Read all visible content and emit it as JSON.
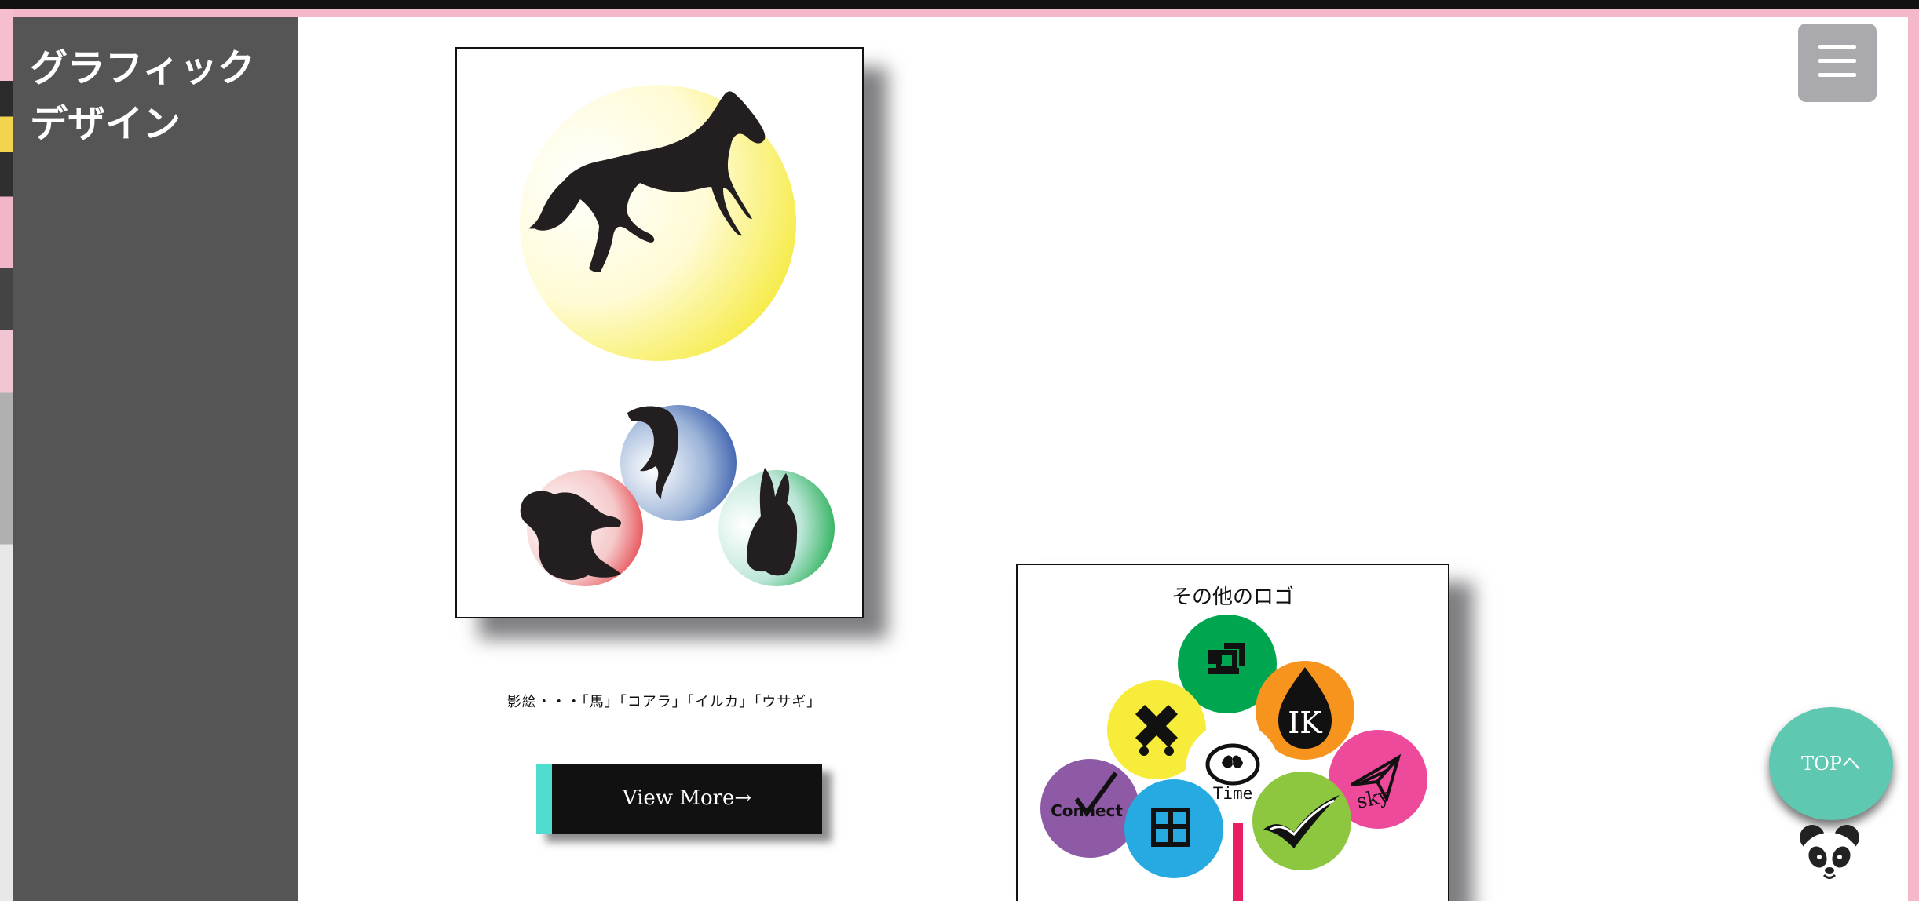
{
  "sidebar": {
    "title": "グラフィック\nデザイン"
  },
  "header": {
    "menu_icon": "hamburger-menu-icon"
  },
  "gallery": {
    "caption": "影絵・・・「馬」「コアラ」「イルカ」「ウサギ」",
    "view_more_label": "View More→"
  },
  "logo_section": {
    "title": "その他のロゴ",
    "logo_texts": [
      "IK",
      "Time",
      "Connect",
      "sky"
    ]
  },
  "floating": {
    "top_label": "TOPへ",
    "mascot_icon": "panda-icon"
  },
  "colors": {
    "sidebar": "#555555",
    "button_accent": "#4fddd0",
    "top_button": "#5ec8b0",
    "green": "#00a550",
    "orange": "#f7941d",
    "pink": "#ee4a9c",
    "lime": "#8dc63f",
    "blue": "#27aae1",
    "purple": "#8f5aa5",
    "yellow": "#f7ec3a"
  }
}
